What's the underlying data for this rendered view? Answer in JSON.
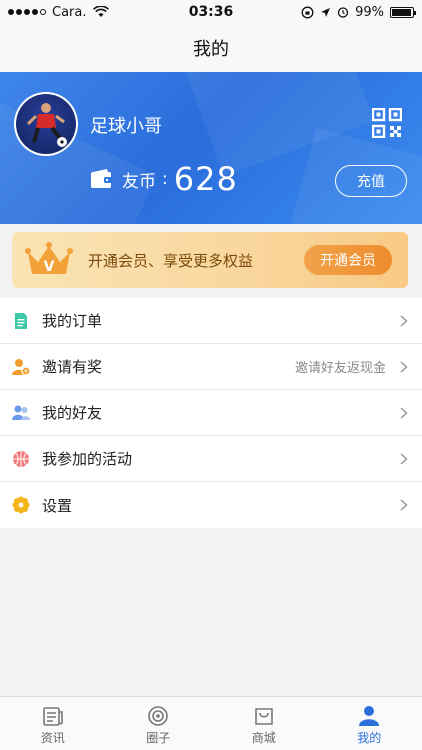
{
  "status_bar": {
    "carrier": "Cara.",
    "time": "03:36",
    "battery": "99%"
  },
  "nav": {
    "title": "我的"
  },
  "profile": {
    "username": "足球小哥",
    "coin_label": "友币",
    "coin_sep": ":",
    "coin_value": "628",
    "recharge_label": "充值"
  },
  "vip": {
    "text": "开通会员、享受更多权益",
    "button_label": "开通会员"
  },
  "menu": {
    "items": [
      {
        "label": "我的订单",
        "hint": "",
        "icon": "order-icon",
        "color": "#3cc9a7"
      },
      {
        "label": "邀请有奖",
        "hint": "邀请好友返现金",
        "icon": "invite-icon",
        "color": "#f39c2c"
      },
      {
        "label": "我的好友",
        "hint": "",
        "icon": "friends-icon",
        "color": "#6a9bea"
      },
      {
        "label": "我参加的活动",
        "hint": "",
        "icon": "basketball-icon",
        "color": "#ef7b7b"
      },
      {
        "label": "设置",
        "hint": "",
        "icon": "settings-icon",
        "color": "#f5b41a"
      }
    ]
  },
  "tabs": [
    {
      "label": "资讯",
      "icon": "news-icon",
      "active": false
    },
    {
      "label": "圈子",
      "icon": "circle-icon",
      "active": false
    },
    {
      "label": "商城",
      "icon": "shop-icon",
      "active": false
    },
    {
      "label": "我的",
      "icon": "profile-icon",
      "active": true
    }
  ],
  "colors": {
    "primary": "#2b6fdd",
    "vip_button": "#ec8c2c"
  }
}
